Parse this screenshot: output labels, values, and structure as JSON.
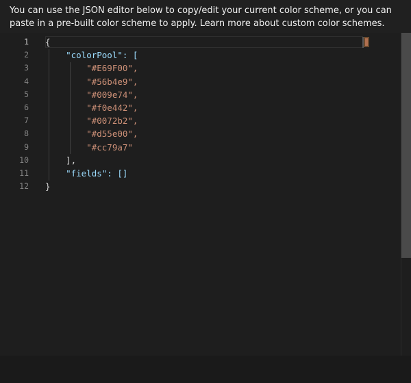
{
  "intro": {
    "text": "You can use the JSON editor below to copy/edit your current color scheme, or you can paste in a pre-built color scheme to apply. ",
    "link_text": "Learn more about custom color schemes."
  },
  "editor": {
    "line_numbers": [
      "1",
      "2",
      "3",
      "4",
      "5",
      "6",
      "7",
      "8",
      "9",
      "10",
      "11",
      "12"
    ],
    "lines": [
      "{",
      "    \"colorPool\": [",
      "        \"#E69F00\",",
      "        \"#56b4e9\",",
      "        \"#009e74\",",
      "        \"#f0e442\",",
      "        \"#0072b2\",",
      "        \"#d55e00\",",
      "        \"#cc79a7\"",
      "    ],",
      "    \"fields\": []",
      "}"
    ],
    "colors": {
      "key": "#9cdcfe",
      "string": "#ce9178",
      "punctuation": "#d4d4d4",
      "line_number": "#858585",
      "background": "#1e1e1e"
    }
  },
  "icons": {
    "minimap": "minimap-slider-icon"
  }
}
